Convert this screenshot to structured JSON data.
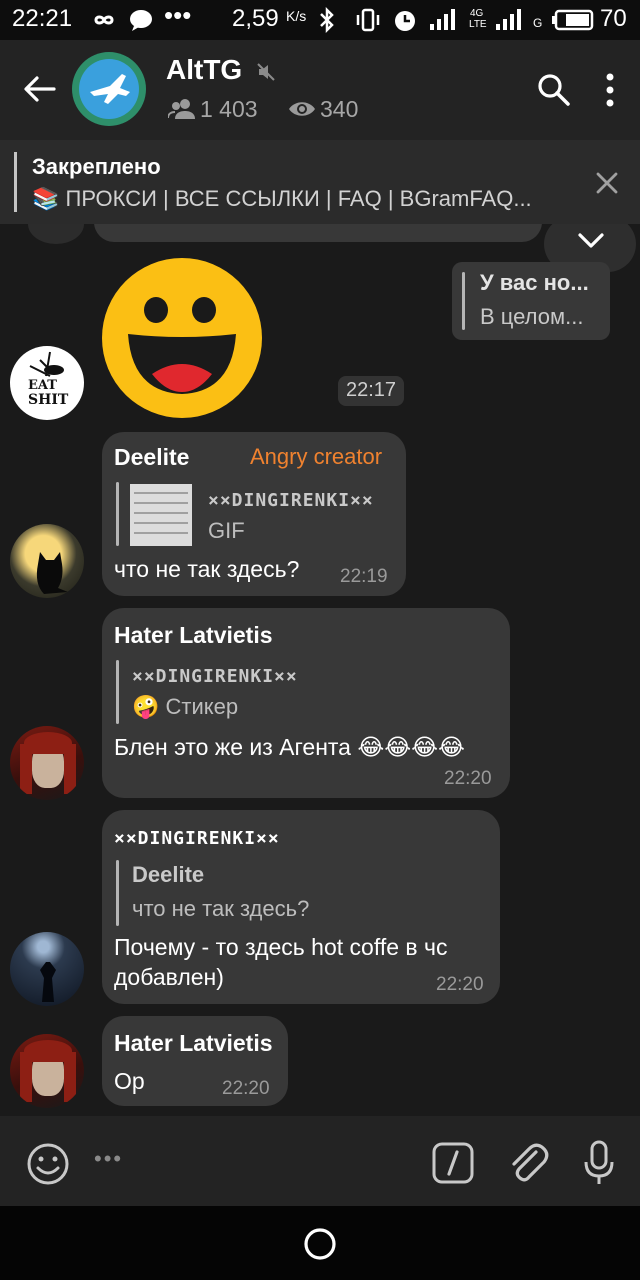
{
  "status_bar": {
    "time": "22:21",
    "speed": "2,59",
    "speed_unit": "K/s",
    "battery": "70",
    "net_4g": "4G",
    "net_lte": "LTE",
    "net_g": "G"
  },
  "header": {
    "title": "AltTG",
    "members": "1 403",
    "online": "340"
  },
  "pinned": {
    "label": "Закреплено",
    "text": "📚 ПРОКСИ | ВСЕ ССЫЛКИ | FAQ | BGramFAQ..."
  },
  "messages": {
    "forwarded": {
      "line1": "У вас но...",
      "line2": "В целом..."
    },
    "sticker": {
      "time": "22:17"
    },
    "msg1": {
      "name": "Deelite",
      "role": "Angry creator",
      "reply_name": "××DINGIRENKI××",
      "reply_text": "GIF",
      "text": "что не так здесь?",
      "time": "22:19"
    },
    "msg2": {
      "name": "Hater Latvietis",
      "reply_name": "××DINGIRENKI××",
      "reply_text": "🤪 Стикер",
      "text": "Блен это же из Агента 😂😂😂😂",
      "time": "22:20"
    },
    "msg3": {
      "name": "××DINGIRENKI××",
      "reply_name": "Deelite",
      "reply_text": "что не так здесь?",
      "text_line1": "Почему - то здесь hot coffe в чс",
      "text_line2": "добавлен)",
      "time": "22:20"
    },
    "msg4": {
      "name": "Hater Latvietis",
      "text": "Ор",
      "time": "22:20"
    }
  },
  "avatar_eat_shit": {
    "line1": "EAT",
    "line2": "SHIT"
  },
  "colors": {
    "accent_role": "#f0822f",
    "bubble": "#383838",
    "background": "#1a1a1a"
  }
}
